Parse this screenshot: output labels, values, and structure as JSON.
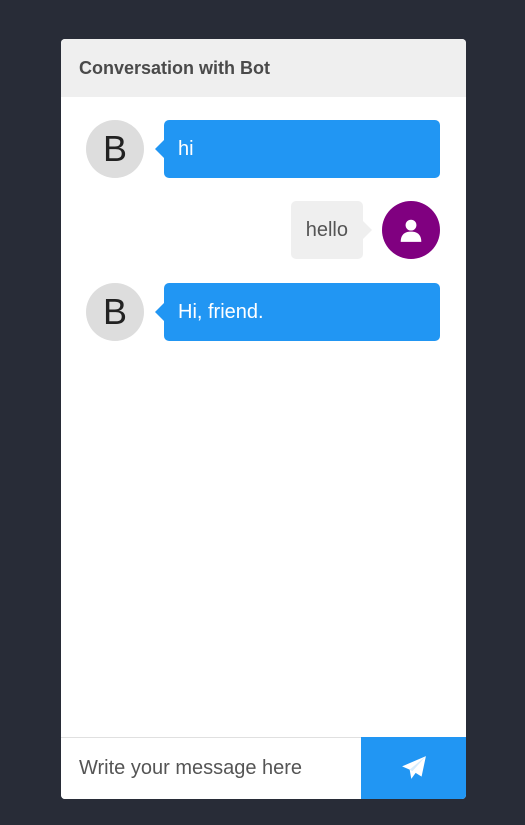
{
  "header": {
    "title": "Conversation with Bot"
  },
  "messages": [
    {
      "sender": "bot",
      "avatar_letter": "B",
      "text": "hi"
    },
    {
      "sender": "user",
      "avatar_icon": "user-icon",
      "text": "hello"
    },
    {
      "sender": "bot",
      "avatar_letter": "B",
      "text": "Hi, friend."
    }
  ],
  "composer": {
    "placeholder": "Write your message here",
    "send_icon": "paper-plane-icon"
  },
  "colors": {
    "background": "#282c37",
    "bot_bubble": "#2196f3",
    "user_bubble": "#efefef",
    "user_avatar": "#800080",
    "bot_avatar": "#dddddd",
    "header": "#efefef",
    "send_button": "#2196f3"
  }
}
